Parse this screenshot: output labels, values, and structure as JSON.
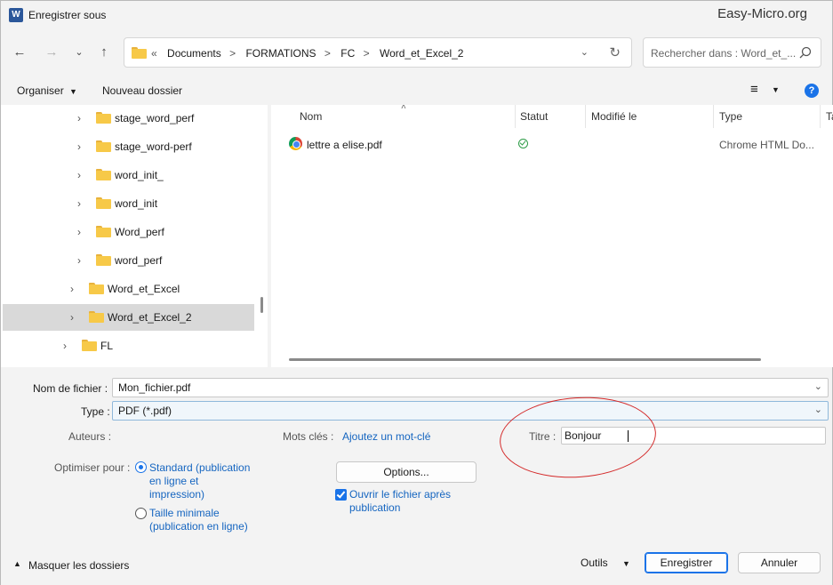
{
  "titlebar": {
    "title": "Enregistrer sous",
    "brand": "Easy-Micro.org",
    "app_icon": "W"
  },
  "nav": {
    "back_icon": "arrow-left-icon",
    "forward_icon": "arrow-right-icon",
    "recent_icon": "chevron-down-icon",
    "up_icon": "arrow-up-icon",
    "breadcrumb_prefix": "«",
    "breadcrumbs": [
      "Documents",
      "FORMATIONS",
      "FC",
      "Word_et_Excel_2"
    ],
    "separator": ">",
    "search_placeholder": "Rechercher dans : Word_et_..."
  },
  "toolbar": {
    "organize": "Organiser",
    "new_folder": "Nouveau dossier",
    "help": "?"
  },
  "tree": {
    "items": [
      {
        "label": "stage_word_perf"
      },
      {
        "label": "stage_word-perf"
      },
      {
        "label": "word_init_"
      },
      {
        "label": "word_init"
      },
      {
        "label": "Word_perf"
      },
      {
        "label": "word_perf"
      },
      {
        "label": "Word_et_Excel"
      },
      {
        "label": "Word_et_Excel_2"
      },
      {
        "label": "FL"
      }
    ]
  },
  "file_list": {
    "columns": [
      "Nom",
      "Statut",
      "Modifié le",
      "Type",
      "Ta"
    ],
    "rows": [
      {
        "name": "lettre a elise.pdf",
        "status": "synced",
        "modified": "",
        "type": "Chrome HTML Do..."
      }
    ]
  },
  "form": {
    "filename_label": "Nom de fichier :",
    "filename_value": "Mon_fichier.pdf",
    "type_label": "Type :",
    "type_value": "PDF (*.pdf)",
    "authors_label": "Auteurs :",
    "keywords_label": "Mots clés :",
    "keywords_link": "Ajoutez un mot-clé",
    "title_label": "Titre :",
    "title_value": "Bonjour",
    "optimize_label": "Optimiser pour :",
    "opt_standard_1": "Standard (publication",
    "opt_standard_2": "en ligne et",
    "opt_standard_3": "impression)",
    "opt_min_1": "Taille minimale",
    "opt_min_2": "(publication en ligne)",
    "options_button": "Options...",
    "open_after_1": "Ouvrir le fichier après",
    "open_after_2": "publication"
  },
  "footer": {
    "hide_folders": "Masquer les dossiers",
    "tools": "Outils",
    "save": "Enregistrer",
    "cancel": "Annuler"
  },
  "colors": {
    "accent": "#1a73e8",
    "annotation": "#d42a2a",
    "folder": "#f7c948"
  }
}
